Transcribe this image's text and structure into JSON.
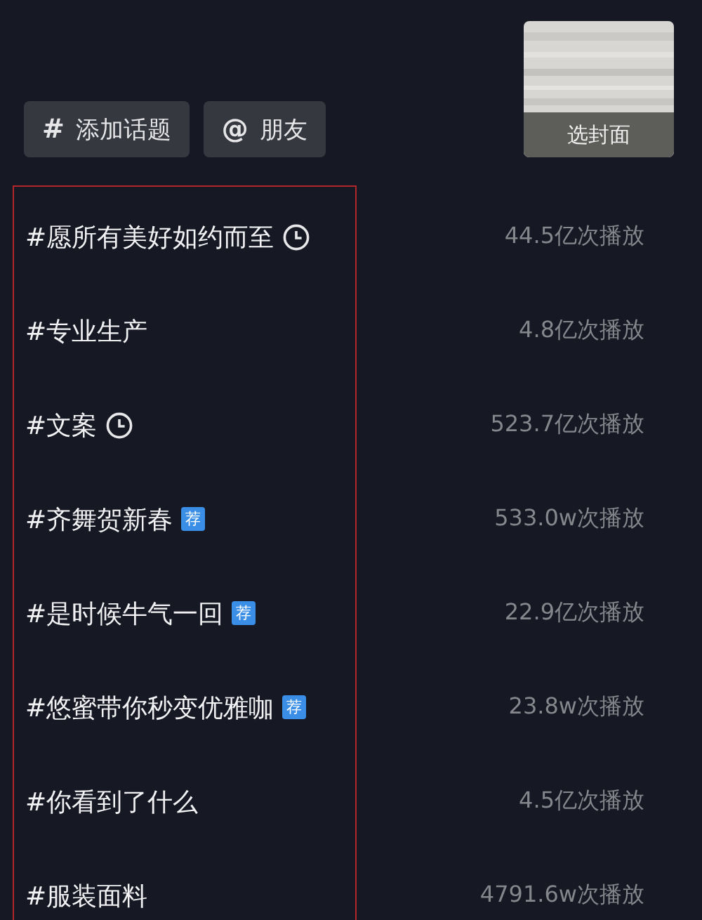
{
  "toolbar": {
    "buttons": [
      {
        "icon": "#",
        "label": "添加话题"
      },
      {
        "icon": "@",
        "label": "朋友"
      }
    ]
  },
  "cover": {
    "kind": "picture",
    "label": "选封面"
  },
  "topics": [
    {
      "title": "#愿所有美好如约而至",
      "badge": {
        "kind": "clock"
      },
      "plays": "44.5亿次播放"
    },
    {
      "title": "#专业生产",
      "plays": "4.8亿次播放"
    },
    {
      "title": "#文案",
      "badge": {
        "kind": "clock"
      },
      "plays": "523.7亿次播放"
    },
    {
      "title": "#齐舞贺新春",
      "badge": {
        "kind": "recommend",
        "text": "荐"
      },
      "plays": "533.0w次播放"
    },
    {
      "title": "#是时候牛气一回",
      "badge": {
        "kind": "recommend",
        "text": "荐"
      },
      "plays": "22.9亿次播放"
    },
    {
      "title": "#悠蜜带你秒变优雅咖",
      "badge": {
        "kind": "recommend",
        "text": "荐"
      },
      "plays": "23.8w次播放"
    },
    {
      "title": "#你看到了什么",
      "plays": "4.5亿次播放"
    },
    {
      "title": "#服装面料",
      "plays": "4791.6w次播放"
    }
  ]
}
